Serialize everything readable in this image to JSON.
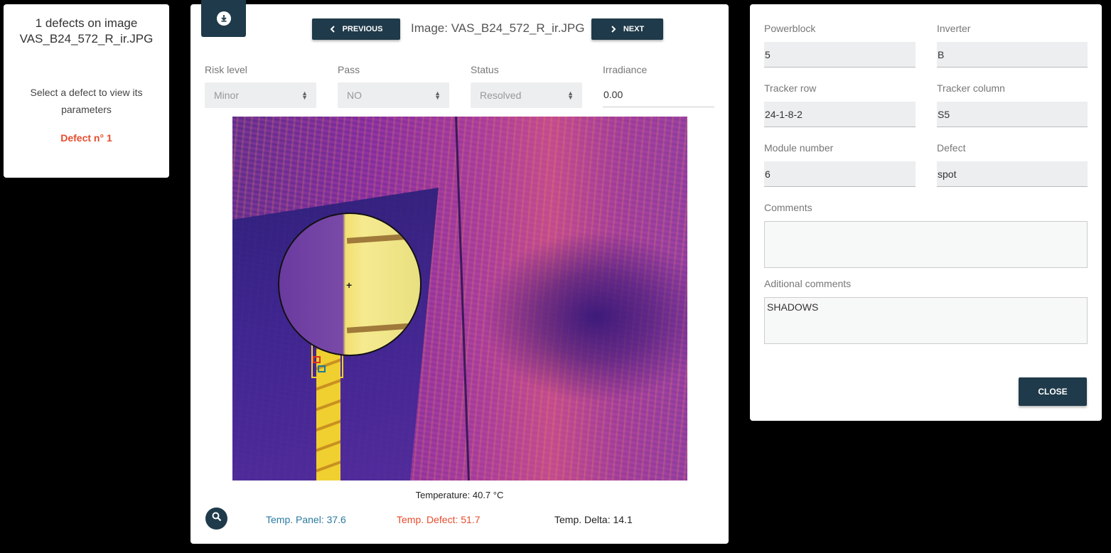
{
  "left_panel": {
    "title_line1": "1 defects on image",
    "title_line2": "VAS_B24_572_R_ir.JPG",
    "hint": "Select a defect to view its parameters",
    "defect_link": "Defect n° 1"
  },
  "viewer": {
    "prev_label": "PREVIOUS",
    "next_label": "NEXT",
    "image_title": "Image: VAS_B24_572_R_ir.JPG",
    "fields": {
      "risk_label": "Risk level",
      "risk_value": "Minor",
      "pass_label": "Pass",
      "pass_value": "NO",
      "status_label": "Status",
      "status_value": "Resolved",
      "irradiance_label": "Irradiance",
      "irradiance_value": "0.00"
    },
    "temperature": "Temperature: 40.7 °C",
    "temp_panel": "Temp. Panel: 37.6",
    "temp_defect": "Temp. Defect: 51.7",
    "temp_delta": "Temp. Delta: 14.1"
  },
  "details": {
    "powerblock_label": "Powerblock",
    "powerblock_value": "5",
    "inverter_label": "Inverter",
    "inverter_value": "B",
    "tracker_row_label": "Tracker row",
    "tracker_row_value": "24-1-8-2",
    "tracker_column_label": "Tracker column",
    "tracker_column_value": "S5",
    "module_number_label": "Module number",
    "module_number_value": "6",
    "defect_label": "Defect",
    "defect_value": "spot",
    "comments_label": "Comments",
    "comments_value": "",
    "additional_label": "Aditional comments",
    "additional_value": "SHADOWS",
    "close_label": "CLOSE"
  },
  "colors": {
    "primary": "#1f3a4a",
    "defect_red": "#e74c2c",
    "panel_blue": "#2a7aa0"
  },
  "icons": [
    "download-icon",
    "chevron-left-icon",
    "chevron-right-icon",
    "zoom-icon",
    "select-arrows-icon",
    "crosshair-icon"
  ]
}
